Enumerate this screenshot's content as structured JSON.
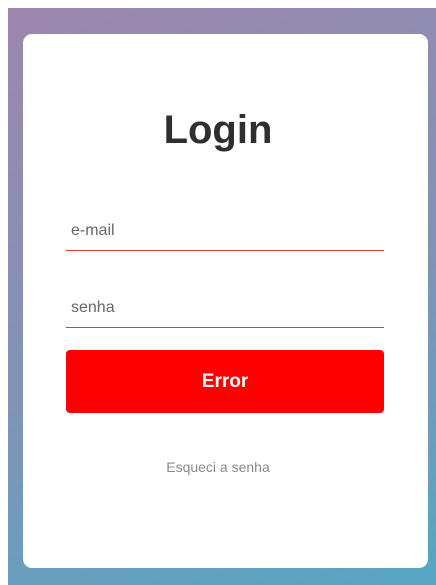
{
  "login": {
    "title": "Login",
    "email_placeholder": "e-mail",
    "password_placeholder": "senha",
    "submit_label": "Error",
    "forgot_link": "Esqueci a senha"
  },
  "colors": {
    "accent": "#ff0000",
    "underline": "#e53935",
    "background_gradient_start": "#9d86ad",
    "background_gradient_end": "#56a6c4"
  }
}
